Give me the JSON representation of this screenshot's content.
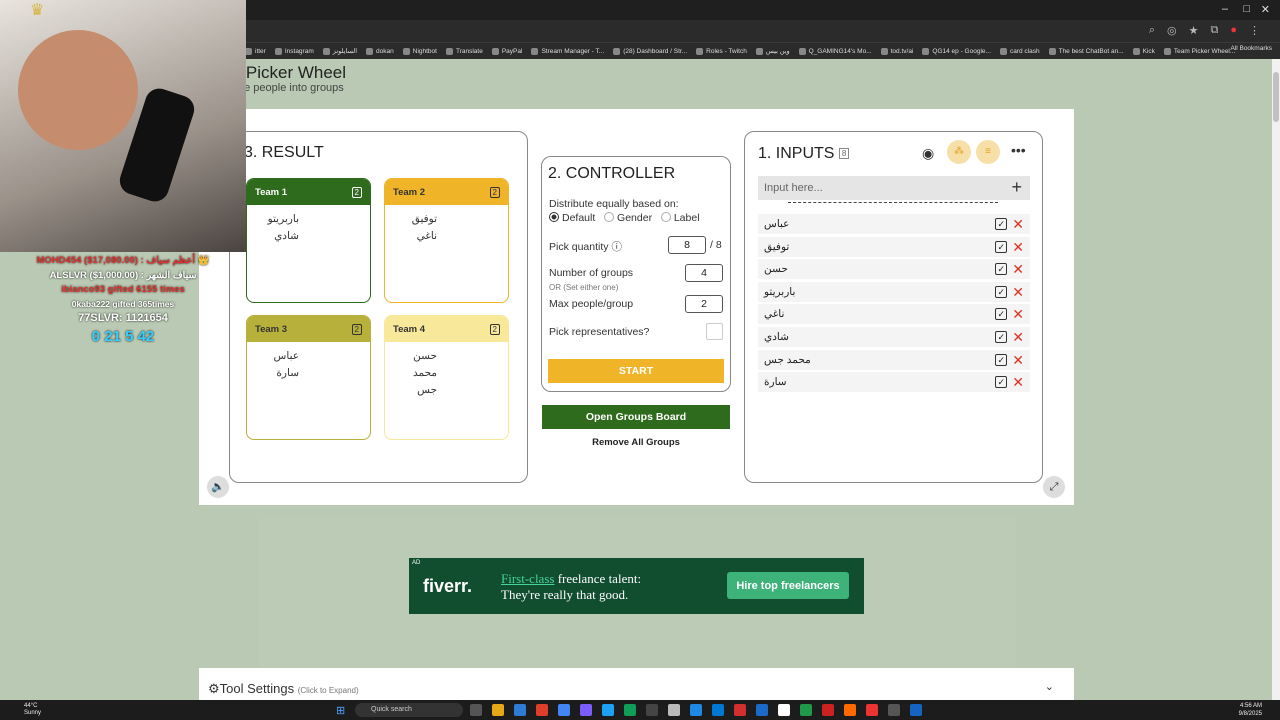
{
  "browser": {
    "bookmarks": [
      "itter",
      "Instagram",
      "السايلونز",
      "dokan",
      "Nightbot",
      "Translate",
      "PayPal",
      "Stream Manager - T...",
      "(28) Dashboard / Str...",
      "Roles - Twitch",
      "وين بيس",
      "Q_GAMING14's Mo...",
      "tod.tv/ai",
      "QG14 ep - Google...",
      "card clash",
      "The best ChatBot an...",
      "Kick",
      "Team Picker Wheel..."
    ],
    "all_bookmarks": "All Bookmarks"
  },
  "site": {
    "title": "m Picker Wheel",
    "subtitle": "mize people into groups"
  },
  "result": {
    "title": "3. RESULT",
    "teams": [
      {
        "name": "Team 1",
        "count": "2",
        "members": [
          "باربريتو",
          "شادي"
        ],
        "color": "#2e6b1d",
        "text": "#ffffff",
        "border": "#2e6b1d"
      },
      {
        "name": "Team 2",
        "count": "2",
        "members": [
          "توفيق",
          "ناغي"
        ],
        "color": "#f0b429",
        "text": "#333333",
        "border": "#f0b429"
      },
      {
        "name": "Team 3",
        "count": "2",
        "members": [
          "عباس",
          "سارة"
        ],
        "color": "#b7b03a",
        "text": "#333333",
        "border": "#b7b03a"
      },
      {
        "name": "Team 4",
        "count": "2",
        "members": [
          "حسن",
          "محمد جس"
        ],
        "color": "#f7e89a",
        "text": "#333333",
        "border": "#f7e89a"
      }
    ]
  },
  "controller": {
    "title": "2. CONTROLLER",
    "distribute_label": "Distribute equally based on:",
    "options": [
      "Default",
      "Gender",
      "Label"
    ],
    "selected": "Default",
    "pick_quantity_label": "Pick quantity",
    "pick_quantity": "8",
    "pick_total": "/ 8",
    "groups_label": "Number of groups",
    "groups": "4",
    "or_note": "OR (Set either one)",
    "max_people_label": "Max people/group",
    "max_people": "2",
    "representatives_label": "Pick representatives?",
    "start": "START",
    "open_groups": "Open Groups Board",
    "remove_groups": "Remove All Groups"
  },
  "inputs": {
    "title": "1. INPUTS",
    "count": "8",
    "placeholder": "Input here...",
    "entries": [
      "عباس",
      "توفيق",
      "حسن",
      "باربريتو",
      "ناغي",
      "شادي",
      "محمد جس",
      "سارة"
    ]
  },
  "ad": {
    "label": "AD",
    "logo": "fiverr.",
    "line1_highlight": "First-class",
    "line1": " freelance talent:",
    "line2": "They're really that good.",
    "cta": "Hire top freelancers"
  },
  "tool_settings": {
    "title": "Tool Settings",
    "hint": "(Click to Expand)"
  },
  "stream_overlay": {
    "lines": [
      {
        "text": "MOHD454 ($17,080.00) : أعظم سياف 👑",
        "color": "#e0312e"
      },
      {
        "text": "ALSLVR ($1,000.00) : سياف الشهر",
        "color": "#ffffff"
      },
      {
        "text": "ibianco93 gifted 6155 times",
        "color": "#e0312e"
      },
      {
        "text": "0kaba222 gifted 365times",
        "color": "#ffffff"
      },
      {
        "text": "77SLVR: 1121654",
        "color": "#ffffff"
      },
      {
        "text": "0  21  5  42",
        "color": "#33d0ff"
      }
    ]
  },
  "taskbar": {
    "weather_temp": "44°C",
    "weather_desc": "Sunny",
    "search": "Quick search",
    "time": "4:56 AM",
    "date": "9/8/2025"
  }
}
